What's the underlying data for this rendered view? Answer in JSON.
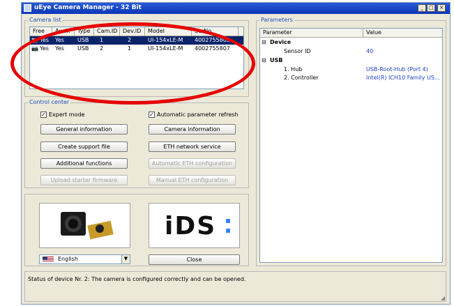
{
  "window": {
    "title": "uEye Camera Manager - 32 Bit",
    "minimize": "_",
    "maximize": "□",
    "close": "×"
  },
  "camera_list": {
    "group_label": "Camera list",
    "columns": [
      "Free",
      "Avail.",
      "Type",
      "Cam.ID",
      "Dev.ID",
      "Model",
      "SerNo."
    ],
    "rows": [
      [
        "Yes",
        "Yes",
        "USB",
        "1",
        "2",
        "UI-154xLE-M",
        "4002755803"
      ],
      [
        "Yes",
        "Yes",
        "USB",
        "2",
        "1",
        "UI-154xLE-M",
        "4002755807"
      ]
    ]
  },
  "control_center": {
    "group_label": "Control center",
    "expert_mode": "Expert mode",
    "auto_refresh": "Automatic parameter refresh",
    "buttons": {
      "general_information": "General information",
      "camera_information": "Camera information",
      "create_support_file": "Create support file",
      "eth_network_service": "ETH network service",
      "additional_functions": "Additional functions",
      "automatic_eth_configuration": "Automatic ETH configuration",
      "upload_starter_firmware": "Upload starter firmware",
      "manual_eth_configuration": "Manual ETH configuration"
    }
  },
  "logo": {
    "text": "iDS"
  },
  "language": {
    "selected": "English"
  },
  "close_button": "Close",
  "parameters": {
    "group_label": "Parameters",
    "col_parameter": "Parameter",
    "col_value": "Value",
    "device_group": "Device",
    "sensor_id_label": "Sensor ID",
    "sensor_id_value": "40",
    "usb_group": "USB",
    "hub_label": "1. Hub",
    "hub_value": "USB-Root-Hub (Port 4)",
    "controller_label": "2. Controller",
    "controller_value": "Intel(R) ICH10 Family US..."
  },
  "status": {
    "text": "Status of device Nr. 2: The camera is configured correctly and can be opened."
  },
  "colors": {
    "title_bar": "#0a36b8",
    "selection": "#0a246a",
    "group_label": "#1f50c8",
    "value_text": "#1f3fc8",
    "annotation": "#e60000"
  }
}
